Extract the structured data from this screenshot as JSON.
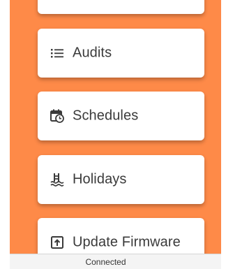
{
  "menu": {
    "items": [
      {
        "label": "Audits",
        "icon": "list-icon"
      },
      {
        "label": "Schedules",
        "icon": "calendar-clock-icon"
      },
      {
        "label": "Holidays",
        "icon": "pool-icon"
      },
      {
        "label": "Update Firmware",
        "icon": "upload-icon"
      }
    ]
  },
  "status": {
    "text": "Connected"
  },
  "colors": {
    "background": "#fe8a48",
    "card": "#ffffff",
    "text": "#3a3a3a",
    "status_bar": "#f4f4f4"
  }
}
